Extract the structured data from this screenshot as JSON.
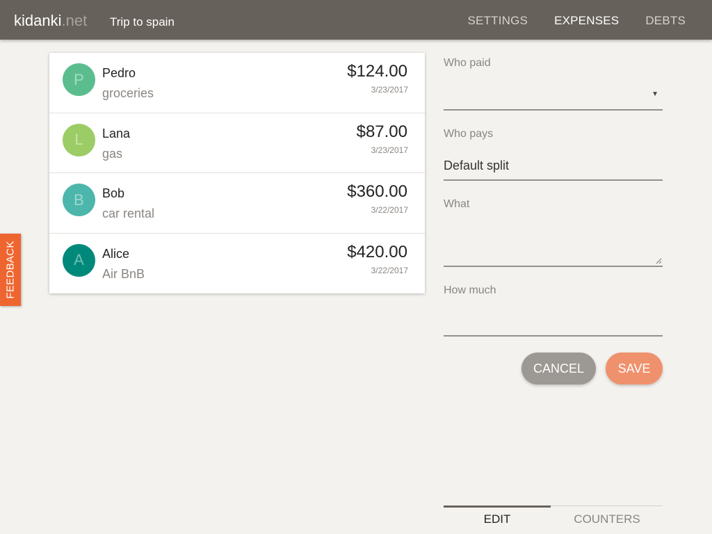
{
  "header": {
    "brand_name": "kidanki",
    "brand_tld": ".net",
    "trip_title": "Trip to spain",
    "nav": [
      {
        "label": "SETTINGS",
        "active": false
      },
      {
        "label": "EXPENSES",
        "active": true
      },
      {
        "label": "DEBTS",
        "active": false
      }
    ]
  },
  "expenses": [
    {
      "initial": "P",
      "payer": "Pedro",
      "description": "groceries",
      "amount": "$124.00",
      "date": "3/23/2017",
      "avatar_color": "#5bbd8d"
    },
    {
      "initial": "L",
      "payer": "Lana",
      "description": "gas",
      "amount": "$87.00",
      "date": "3/23/2017",
      "avatar_color": "#9ccc65"
    },
    {
      "initial": "B",
      "payer": "Bob",
      "description": "car rental",
      "amount": "$360.00",
      "date": "3/22/2017",
      "avatar_color": "#4db6ac"
    },
    {
      "initial": "A",
      "payer": "Alice",
      "description": "Air BnB",
      "amount": "$420.00",
      "date": "3/22/2017",
      "avatar_color": "#00897b"
    }
  ],
  "form": {
    "who_paid_label": "Who paid",
    "who_paid_value": "",
    "who_pays_label": "Who pays",
    "who_pays_value": "Default split",
    "what_label": "What",
    "what_value": "",
    "how_much_label": "How much",
    "how_much_value": "",
    "cancel_label": "CANCEL",
    "save_label": "SAVE"
  },
  "tabs": [
    {
      "label": "EDIT",
      "active": true
    },
    {
      "label": "COUNTERS",
      "active": false
    }
  ],
  "feedback_label": "FEEDBACK",
  "colors": {
    "header_bg": "#67615b",
    "accent_save": "#ef916c",
    "cancel": "#9c9893",
    "feedback": "#ef6530"
  }
}
